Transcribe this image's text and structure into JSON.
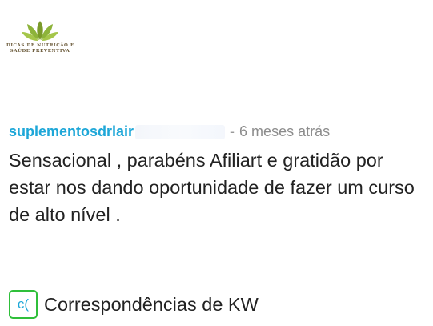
{
  "brand": {
    "logo_icon": "lotus-leaves-icon",
    "line1": "DICAS DE NUTRIÇÃO E",
    "line2": "SAÚDE PREVENTIVA"
  },
  "comment": {
    "username": "suplementosdrlair",
    "separator": "-",
    "time": "6 meses atrás",
    "text": "Sensacional , parabéns Afiliart e gratidão por estar nos dando oportunidade de fazer um curso de alto nível ."
  },
  "keywords": {
    "badge": "c(",
    "label": "Correspondências de KW"
  },
  "colors": {
    "username": "#1ea7d8",
    "badge_border": "#2fbf3a",
    "body_text": "#222222",
    "muted": "#8c8c8c"
  }
}
